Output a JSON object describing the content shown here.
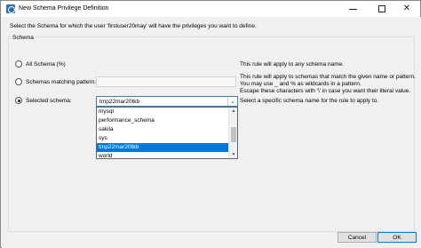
{
  "window": {
    "title": "New Schema Privilege Definition",
    "minimize_label": "",
    "maximize_label": "",
    "close_label": "✕"
  },
  "instruction": "Select the Schema for which the user 'firstuser20may' will have the privileges you want to define.",
  "group": {
    "label": "Schema"
  },
  "options": {
    "all": {
      "label": "All Schema (%)",
      "description": "This rule will apply to any schema name.",
      "checked": false
    },
    "matching": {
      "label": "Schemas matching pattern:",
      "input_value": "",
      "description_lines": [
        "This rule will apply to schemas that match the given name or pattern.",
        "You may use _ and % as wildcards in a pattern.",
        "Escape these characters with '\\' in case you want their literal value."
      ],
      "checked": false
    },
    "selected": {
      "label": "Selected schema:",
      "combo_value": "tmp22mar20tkb",
      "description": "Select a specific schema name for the rule to apply to.",
      "checked": true
    }
  },
  "dropdown": {
    "items": [
      "mysql",
      "performance_schema",
      "sakila",
      "sys",
      "tmp22mar20tkb",
      "world"
    ],
    "selected_index": 4
  },
  "buttons": {
    "cancel": "Cancel",
    "ok": "OK"
  }
}
